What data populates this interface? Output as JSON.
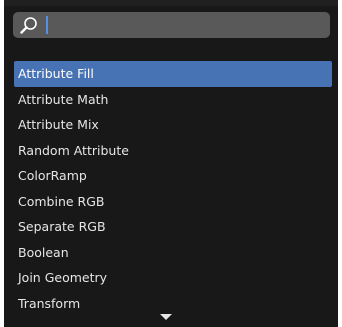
{
  "search": {
    "value": "",
    "icon": "search-icon"
  },
  "menu": {
    "items": [
      {
        "label": "Attribute Fill",
        "active": true
      },
      {
        "label": "Attribute Math",
        "active": false
      },
      {
        "label": "Attribute Mix",
        "active": false
      },
      {
        "label": "Random Attribute",
        "active": false
      },
      {
        "label": "ColorRamp",
        "active": false
      },
      {
        "label": "Combine RGB",
        "active": false
      },
      {
        "label": "Separate RGB",
        "active": false
      },
      {
        "label": "Boolean",
        "active": false
      },
      {
        "label": "Join Geometry",
        "active": false
      },
      {
        "label": "Transform",
        "active": false
      }
    ],
    "scroll_indicator": "chevron-down-icon"
  },
  "colors": {
    "background": "#181818",
    "search_field": "#595959",
    "highlight": "#4772b3",
    "text": "#e6e6e6",
    "caret": "#5690e3"
  }
}
